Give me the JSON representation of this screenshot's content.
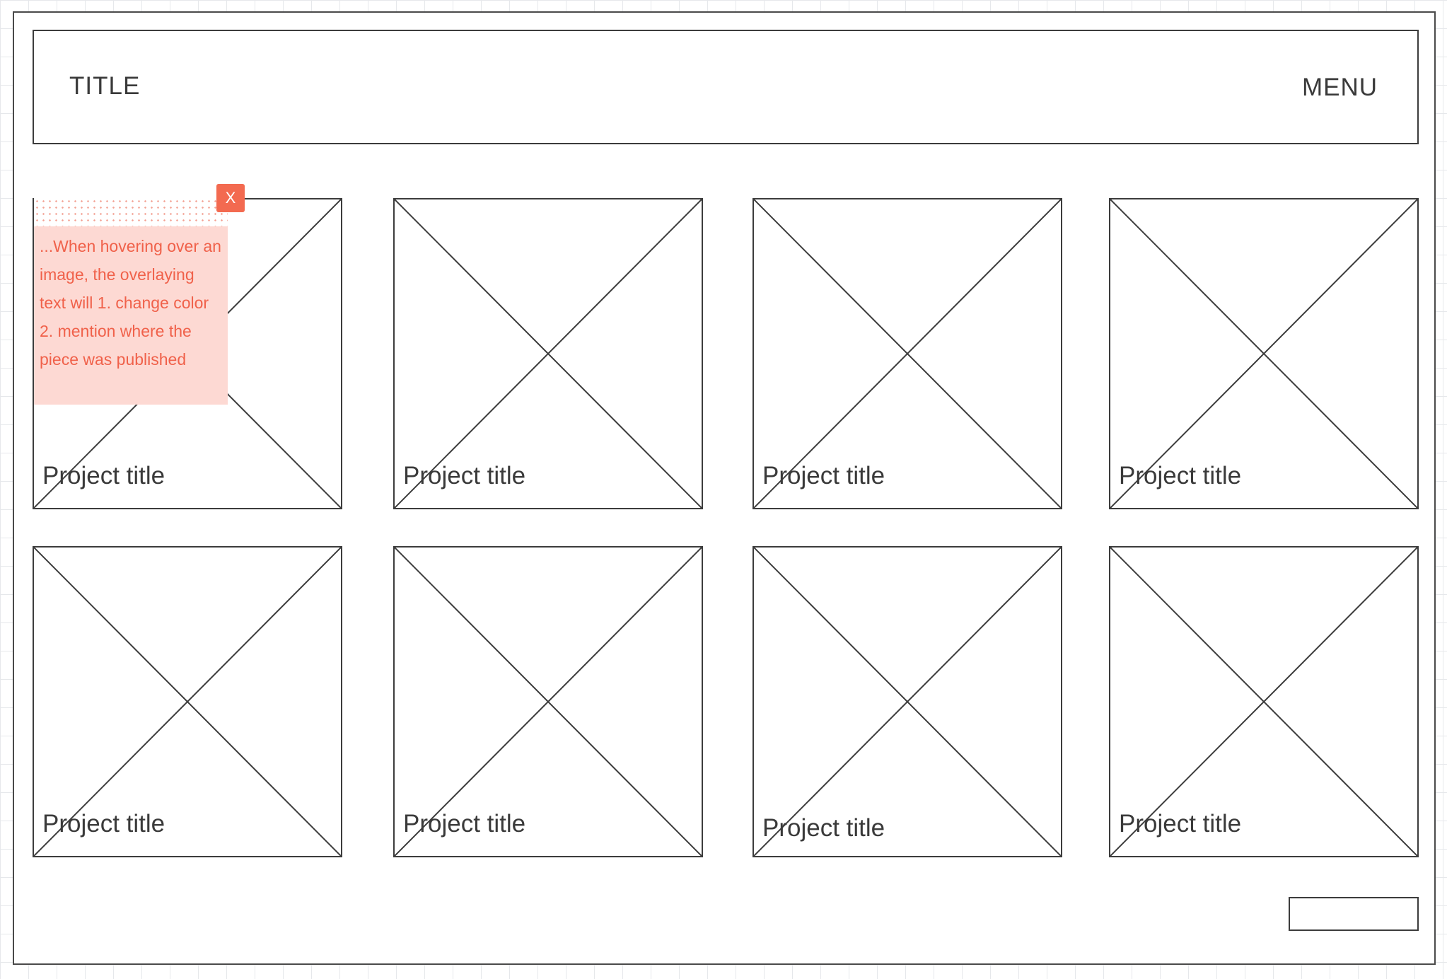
{
  "header": {
    "title": "TITLE",
    "menu_label": "MENU"
  },
  "grid": {
    "cards": [
      {
        "title": "Project title"
      },
      {
        "title": "Project title"
      },
      {
        "title": "Project title"
      },
      {
        "title": "Project title"
      },
      {
        "title": "Project title"
      },
      {
        "title": "Project title"
      },
      {
        "title": "Project title"
      },
      {
        "title": "Project title"
      }
    ]
  },
  "annotation": {
    "text": "...When hovering over an image, the overlaying text will 1. change color 2. mention where the piece was published",
    "close_label": "X",
    "color": "#f0614a",
    "background": "#fdd9d3"
  },
  "footer": {
    "button_label": ""
  }
}
